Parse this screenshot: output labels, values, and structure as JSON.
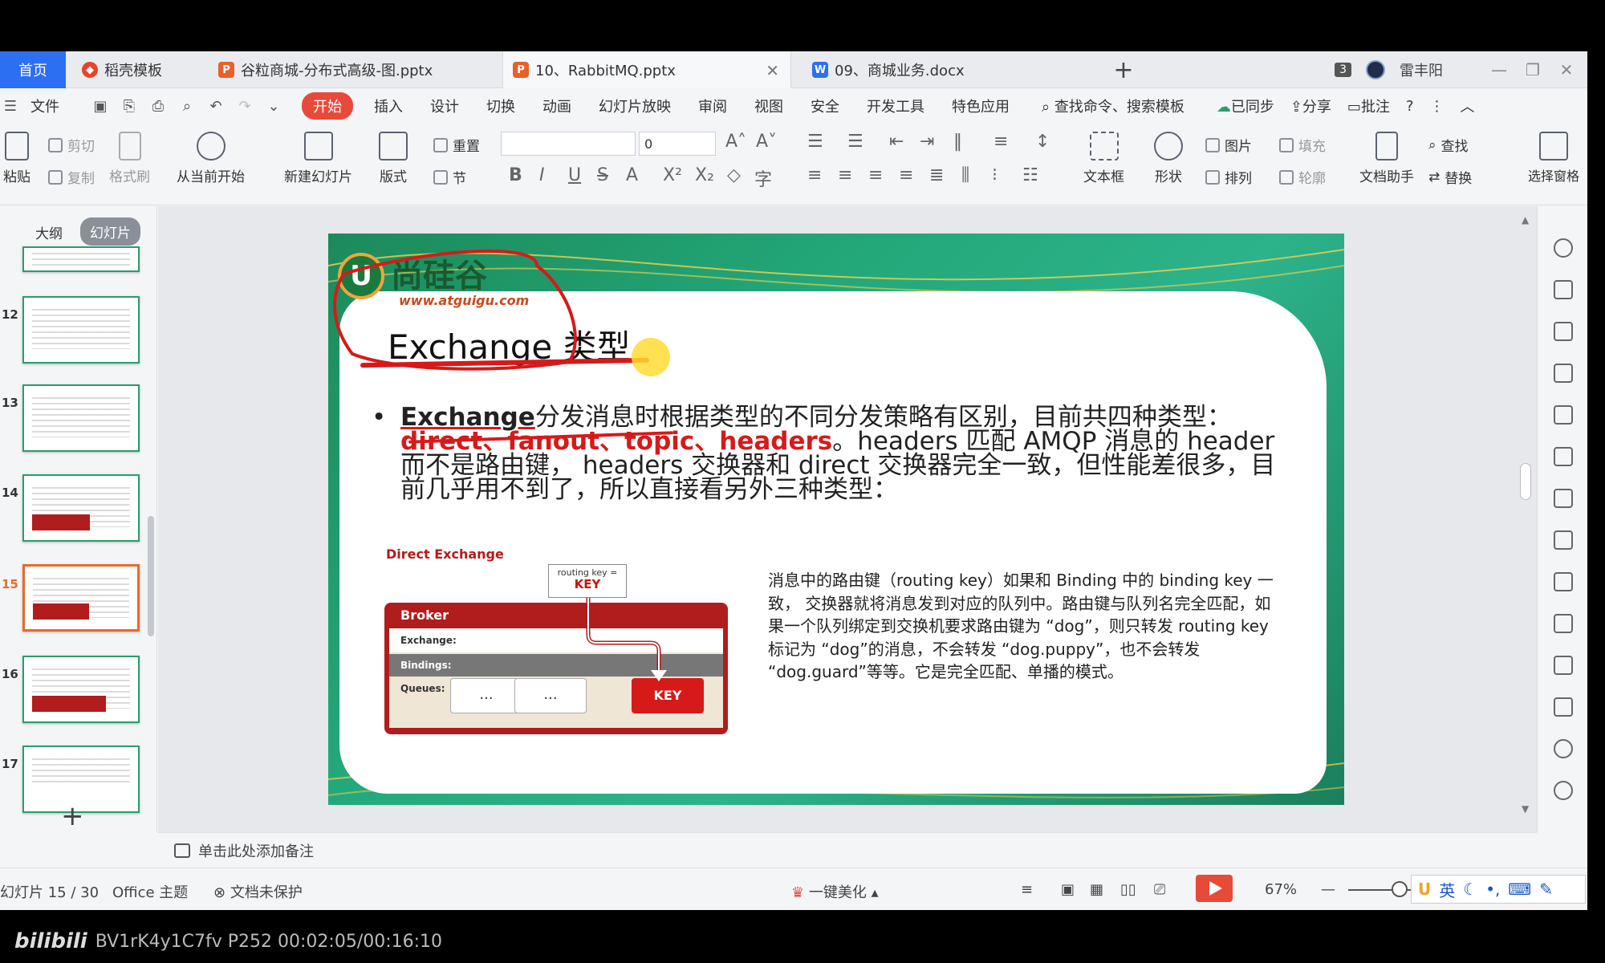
{
  "tabs": {
    "home": "首页",
    "t1": "稻壳模板",
    "t2": "谷粒商城-分布式高级-图.pptx",
    "t3": "10、RabbitMQ.pptx",
    "t4": "09、商城业务.docx",
    "plus": "+",
    "window_count": "3",
    "user": "雷丰阳"
  },
  "menu": {
    "file": "文件",
    "items": [
      "开始",
      "插入",
      "设计",
      "切换",
      "动画",
      "幻灯片放映",
      "审阅",
      "视图",
      "安全",
      "开发工具",
      "特色应用"
    ],
    "search": "查找命令、搜索模板",
    "synced": "已同步",
    "share": "分享",
    "comment": "批注",
    "help": "?"
  },
  "ribbon": {
    "paste": "粘贴",
    "cut": "剪切",
    "copy": "复制",
    "format_painter": "格式刷",
    "play_from_current": "从当前开始",
    "new_slide": "新建幻灯片",
    "layout": "版式",
    "reset": "重置",
    "section": "节",
    "font_size": "0",
    "textbox": "文本框",
    "shape": "形状",
    "picture": "图片",
    "fill": "填充",
    "arrange": "排列",
    "outline": "轮廓",
    "find": "查找",
    "replace": "替换",
    "doc_assistant": "文档助手",
    "selection_pane": "选择窗格"
  },
  "panel": {
    "outline_tab": "大纲",
    "slides_tab": "幻灯片",
    "thumb_numbers": [
      "12",
      "13",
      "14",
      "15",
      "16",
      "17"
    ],
    "selected": "15",
    "add": "+"
  },
  "slide": {
    "logo_name": "尚硅谷",
    "logo_url": "www.atguigu.com",
    "title": "Exchange 类型",
    "bullet_lead": "Exchange",
    "bullet_part1": "分发消息时根据类型的不同分发策略有区别，目前共四种类型：",
    "bullet_types": "direct、fanout、topic、headers",
    "bullet_part2": "。headers 匹配 AMQP 消息的 header 而不是路由键， headers 交换器和 direct 交换器完全一致，但性能差很多，目前几乎用不到了，所以直接看另外三种类型：",
    "diagram": {
      "label": "Direct Exchange",
      "routing_key_caption": "routing key =",
      "routing_key_value": "KEY",
      "broker": "Broker",
      "exchange": "Exchange:",
      "bindings": "Bindings:",
      "queues": "Queues:",
      "queue1": "...",
      "queue2": "...",
      "queue3": "KEY"
    },
    "description": "消息中的路由键（routing key）如果和 Binding 中的 binding key 一致， 交换器就将消息发到对应的队列中。路由键与队列名完全匹配，如果一个队列绑定到交换机要求路由键为 “dog”，则只转发 routing key 标记为 “dog”的消息，不会转发 “dog.puppy”，也不会转发 “dog.guard”等等。它是完全匹配、单播的模式。"
  },
  "notes": {
    "placeholder": "单击此处添加备注"
  },
  "status": {
    "slide_counter": "幻灯片 15 / 30",
    "theme": "Office 主题",
    "protection": "文档未保护",
    "beautify": "一键美化",
    "zoom": "67%",
    "ime": "英"
  },
  "video": {
    "platform": "bilibili",
    "info": "BV1rK4y1C7fv P252 00:02:05/00:16:10"
  },
  "colors": {
    "accent_red": "#d61a1a",
    "slide_green": "#23a87a",
    "active_tab_blue": "#2c6ff2",
    "start_tab": "#e84a3a"
  }
}
